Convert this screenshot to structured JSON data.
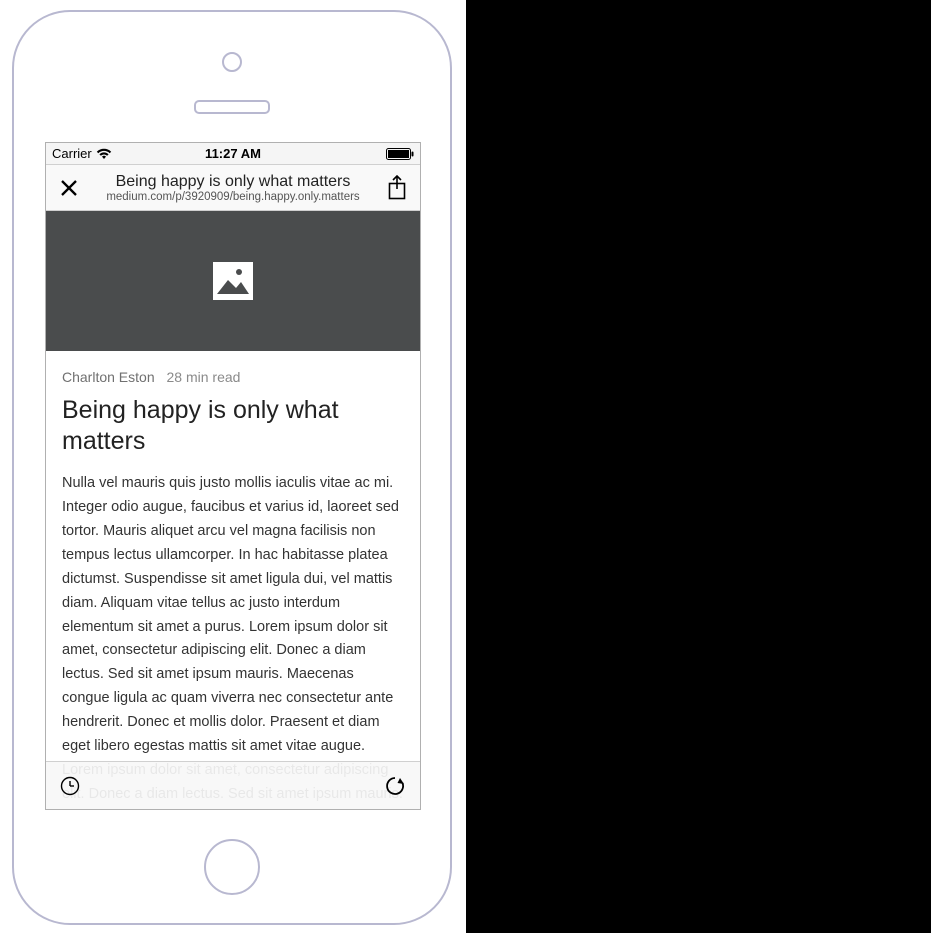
{
  "status_bar": {
    "carrier": "Carrier",
    "time": "11:27 AM"
  },
  "nav": {
    "title": "Being happy is only what matters",
    "subtitle": "medium.com/p/3920909/being.happy.only.matters"
  },
  "article": {
    "author": "Charlton Eston",
    "read_time": "28 min read",
    "headline": "Being happy is only what matters",
    "body": "Nulla vel mauris quis justo mollis iaculis vitae ac mi. Integer odio augue, faucibus et varius id, laoreet sed tortor. Mauris aliquet arcu vel magna facilisis non tempus lectus ullamcorper. In hac habitasse platea dictumst. Suspendisse sit amet ligula dui, vel mattis diam. Aliquam vitae tellus ac justo interdum elementum sit amet a purus. Lorem ipsum dolor sit amet, consectetur adipiscing elit. Donec a diam lectus. Sed sit amet ipsum mauris. Maecenas congue ligula ac quam viverra nec consectetur ante hendrerit. Donec et mollis dolor. Praesent et diam eget libero egestas mattis sit amet vitae augue. Lorem ipsum dolor sit amet, consectetur adipiscing elit. Donec a diam lectus. Sed sit amet ipsum mauris. Maecenas congue ligula ac quam viverra nec"
  }
}
